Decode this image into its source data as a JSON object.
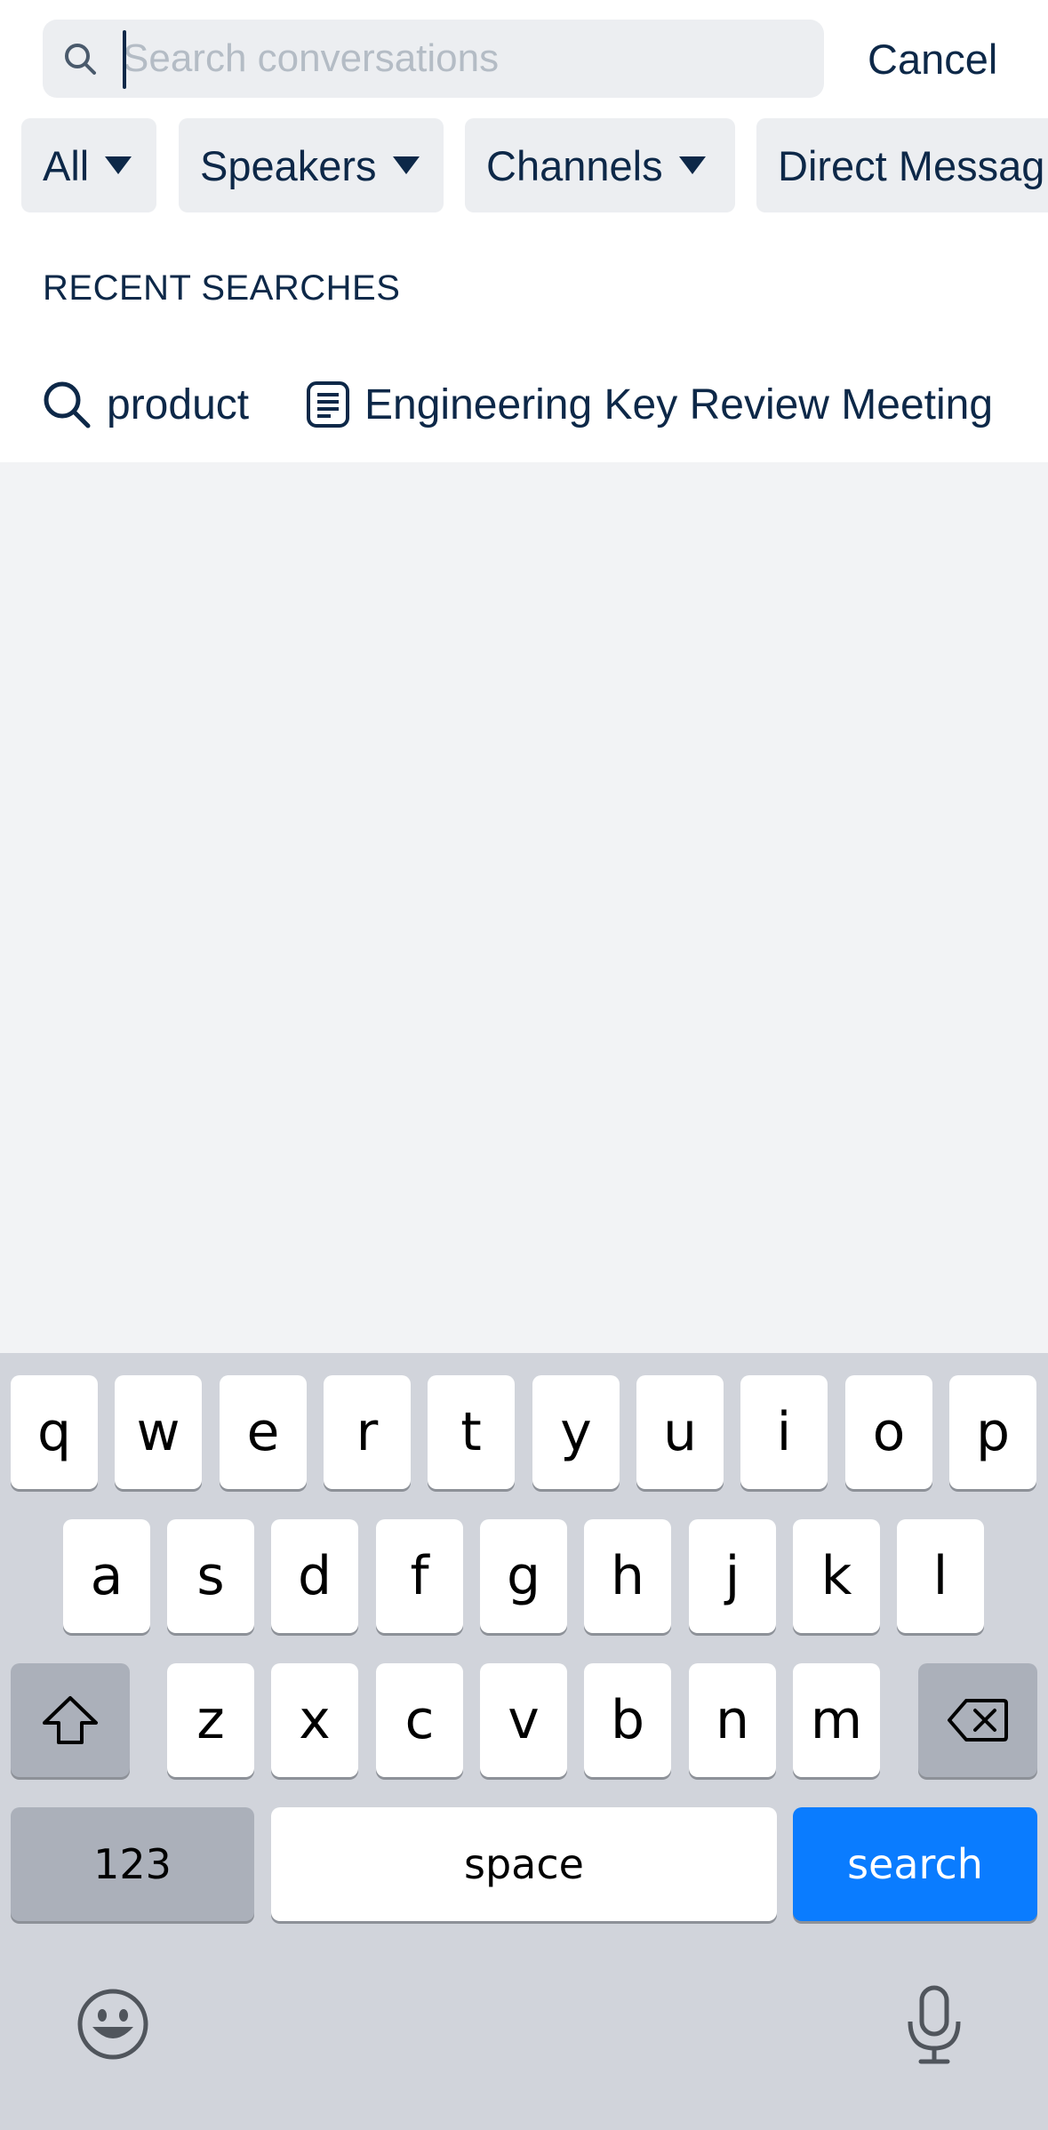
{
  "search": {
    "placeholder": "Search conversations",
    "value": "",
    "cancel_label": "Cancel"
  },
  "filters": [
    {
      "label": "All"
    },
    {
      "label": "Speakers"
    },
    {
      "label": "Channels"
    },
    {
      "label": "Direct Messag"
    }
  ],
  "recent": {
    "title": "RECENT SEARCHES",
    "items": [
      {
        "icon": "search-icon",
        "label": "product"
      },
      {
        "icon": "document-icon",
        "label": "Engineering Key Review Meeting"
      }
    ]
  },
  "keyboard": {
    "row1": [
      "q",
      "w",
      "e",
      "r",
      "t",
      "y",
      "u",
      "i",
      "o",
      "p"
    ],
    "row2": [
      "a",
      "s",
      "d",
      "f",
      "g",
      "h",
      "j",
      "k",
      "l"
    ],
    "row3": [
      "z",
      "x",
      "c",
      "v",
      "b",
      "n",
      "m"
    ],
    "numbers_label": "123",
    "space_label": "space",
    "search_label": "search",
    "shift_icon": "shift-icon",
    "delete_icon": "backspace-icon",
    "emoji_icon": "emoji-icon",
    "mic_icon": "microphone-icon"
  },
  "colors": {
    "accent": "#0a7cff",
    "text": "#0d2848",
    "chip_bg": "#eceef1",
    "page_bg": "#f2f3f5",
    "keyboard_bg": "#d1d4db"
  }
}
